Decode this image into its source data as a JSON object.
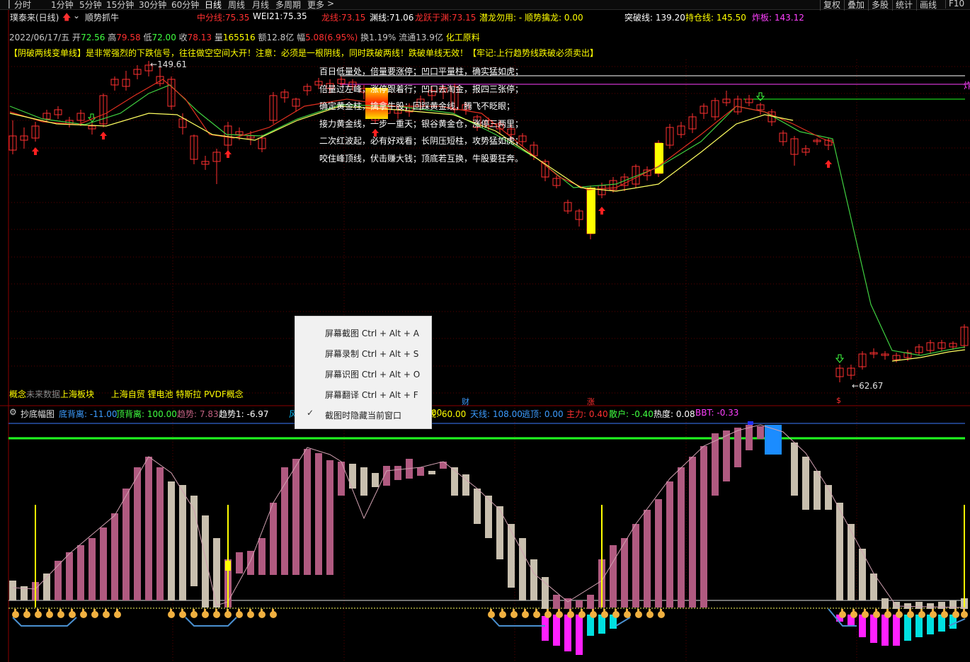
{
  "toolbar": {
    "periods": [
      "分时",
      "1分钟",
      "5分钟",
      "15分钟",
      "30分钟",
      "60分钟",
      "日线",
      "周线",
      "月线",
      "多周期",
      "更多"
    ],
    "more_arrow": ">",
    "right_buttons": [
      "复权",
      "叠加",
      "多股",
      "统计",
      "画线",
      "F10"
    ],
    "active": "日线"
  },
  "stock": {
    "title": "璞泰来(日线)",
    "indicator_name": "顺势抓牛",
    "ma_labels": [
      {
        "label": "中分线:",
        "value": "75.35",
        "color": "#ff3030"
      },
      {
        "label": "WEI21:",
        "value": "75.35",
        "color": "#ffffff"
      },
      {
        "label": "龙线:",
        "value": "73.15",
        "color": "#ff3030"
      },
      {
        "label": "渊线:",
        "value": "71.06",
        "color": "#ffffff"
      },
      {
        "label": "龙跃于渊:",
        "value": "73.15",
        "color": "#ff3030"
      },
      {
        "label": "潜龙勿用:",
        "value": "-",
        "color": "#ffff00"
      },
      {
        "label": "顺势擒龙:",
        "value": "0.00",
        "color": "#ffff00"
      }
    ],
    "right_labels": [
      {
        "label": "突破线:",
        "value": "139.20",
        "color": "#ffffff"
      },
      {
        "label": "持仓线:",
        "value": "145.50",
        "color": "#ffff00"
      },
      {
        "label": "炸板:",
        "value": "143.12",
        "color": "#ff40ff"
      }
    ]
  },
  "quote": {
    "date": "2022/06/17/五",
    "open_label": "开",
    "open": "72.56",
    "high_label": "高",
    "high": "79.58",
    "low_label": "低",
    "low": "72.00",
    "close_label": "收",
    "close": "78.13",
    "vol_label": "量",
    "vol": "165516",
    "amt_label": "额",
    "amt": "12.8亿",
    "chg_label": "幅",
    "chg": "5.08(6.95%)",
    "turn_label": "换",
    "turn": "1.19%",
    "float_label": "流通",
    "float": "13.9亿",
    "sector": "化工原料"
  },
  "notice": "【阴破两线变单线】是非常强烈的下跌信号，往往做空空间大开！注意：必须是一根阴线，同时跌破两线！跌破单线无效！【牢记:上行趋势线跌破必须卖出】",
  "poem": [
    "百日低量处，倍量要涨停；凹口平量柱，确实猛如虎；",
    "倍量过左峰，涨停跟着行；凹口去淘金，报四三张停；",
    "确定黄金柱，擒拿牛股；回踩黄金线，腾飞不眨眼；",
    "接力黄金线，一步一重天；银谷黄金仓，涨停三两里；",
    "二次红波起，必有好戏看；长阴压短柱，攻势猛如虎；",
    "咬住峰顶线，伏击赚大钱；顶底若互换，牛股要狂奔。"
  ],
  "price_marks": {
    "high": "149.61",
    "low": "62.67",
    "right_edge_mark": "炸"
  },
  "sector_line": {
    "label": "概念",
    "future": "未来数据",
    "board": "上海板块",
    "concepts": "上海自贸 锂电池 特斯拉 PVDF概念"
  },
  "event_marks": {
    "cai": "财",
    "zhang": "涨",
    "dollar": "$"
  },
  "sub": {
    "name": "抄底幅图",
    "items": [
      {
        "label": "底背离:",
        "value": "-11.00",
        "color": "#3c9cff"
      },
      {
        "label": "顶背离:",
        "value": "100.00",
        "color": "#40ff40"
      },
      {
        "label": "趋势:",
        "value": "7.83",
        "color": "#c06080"
      },
      {
        "label": "趋势1:",
        "value": "-6.97",
        "color": "#ffffff"
      }
    ],
    "items2": [
      {
        "label": "风险:",
        "value": "",
        "color": "#00c0ff"
      },
      {
        "label": "抄底:",
        "value": "60.00",
        "color": "#ffff00"
      },
      {
        "label": "天线:",
        "value": "108.00",
        "color": "#3c9cff"
      },
      {
        "label": "逃顶:",
        "value": "0.00",
        "color": "#3c9cff"
      },
      {
        "label": "主力:",
        "value": "0.40",
        "color": "#ff3030"
      },
      {
        "label": "散户:",
        "value": "-0.40",
        "color": "#40ff40"
      },
      {
        "label": "热度:",
        "value": "0.08",
        "color": "#ffffff"
      },
      {
        "label": "BBT:",
        "value": "-0.33",
        "color": "#ff40ff"
      }
    ],
    "partial_value": "00"
  },
  "context_menu": [
    {
      "label": "屏幕截图 Ctrl + Alt + A",
      "checked": false
    },
    {
      "label": "屏幕录制 Ctrl + Alt + S",
      "checked": false
    },
    {
      "label": "屏幕识图 Ctrl + Alt + O",
      "checked": false
    },
    {
      "label": "屏幕翻译 Ctrl + Alt + F",
      "checked": false
    },
    {
      "label": "截图时隐藏当前窗口",
      "checked": true
    }
  ],
  "colors": {
    "up": "#ff3030",
    "down": "#54ffff",
    "ma_red": "#e03020",
    "ma_yellow": "#ffff60",
    "ma_green": "#40d040",
    "bar_pink": "#b05a80",
    "bar_beige": "#c8bfae",
    "magenta": "#ff20ff",
    "cyan": "#00e0e0",
    "green_line": "#20ff20",
    "blue_line": "#3c7cff"
  }
}
